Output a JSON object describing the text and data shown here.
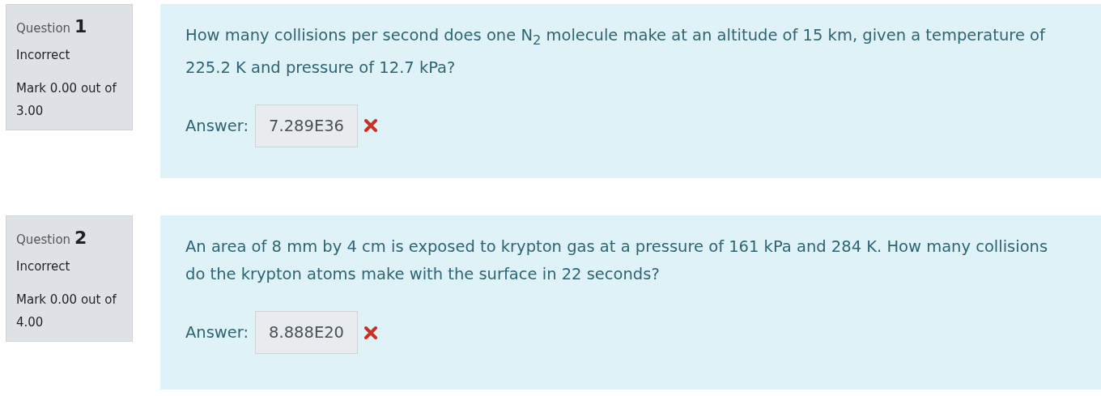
{
  "questions": [
    {
      "label": "Question",
      "number": "1",
      "status": "Incorrect",
      "mark": "Mark 0.00 out of 3.00",
      "text": "How many collisions per second does one N$_{2}$ molecule make at an altitude of 15 km, given a temperature of 225.2 K and pressure of 12.7 kPa?",
      "answer_label": "Answer:",
      "answer": "7.289E36",
      "correct": false
    },
    {
      "label": "Question",
      "number": "2",
      "status": "Incorrect",
      "mark": "Mark 0.00 out of 4.00",
      "text": "An area of 8 mm by 4 cm is exposed to krypton gas at a pressure of 161 kPa and 284 K.  How many collisions do the krypton atoms make with the surface in 22 seconds?",
      "answer_label": "Answer:",
      "answer": "8.888E20",
      "correct": false
    }
  ]
}
